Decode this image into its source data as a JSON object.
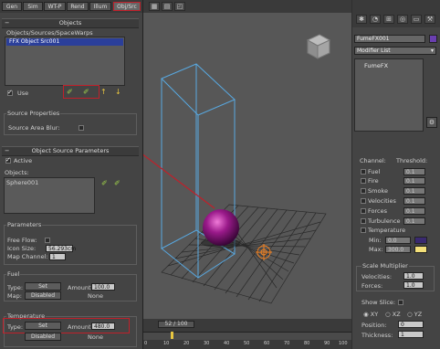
{
  "left_tabs": [
    "Gen",
    "Sim",
    "WT-P",
    "Rend",
    "Illum",
    "Obj/Src"
  ],
  "objects_rollout": {
    "title": "Objects",
    "list_header": "Objects/Sources/SpaceWarps",
    "items": [
      "FFX Object Src001"
    ],
    "use_label": "Use"
  },
  "source_properties": {
    "group_label": "Source Properties",
    "area_blur_label": "Source Area Blur:"
  },
  "object_source_parameters": {
    "title": "Object Source Parameters",
    "active_label": "Active",
    "objects_label": "Objects:",
    "objects_list": [
      "Sphere001"
    ]
  },
  "parameters": {
    "group_label": "Parameters",
    "free_flow_label": "Free Flow:",
    "icon_size_label": "Icon Size:",
    "icon_size_value": "56.293cm",
    "map_channel_label": "Map Channel:",
    "map_channel_value": "1"
  },
  "fuel": {
    "group_label": "Fuel",
    "type_label": "Type:",
    "type_value": "Set",
    "amount_label": "Amount:",
    "amount_value": "100.0",
    "map_label": "Map:",
    "map_value": "Disabled",
    "none_label": "None"
  },
  "temperature": {
    "group_label": "Temperature",
    "type_label": "Type:",
    "type_value": "Set",
    "amount_label": "Amount:",
    "amount_value": "480.0",
    "map_value": "Disabled",
    "none_label": "None"
  },
  "timeline": {
    "frame_label": "52 / 100",
    "ticks": [
      "0",
      "10",
      "20",
      "30",
      "40",
      "50",
      "60",
      "70",
      "80",
      "90",
      "100"
    ]
  },
  "right_panel": {
    "object_name": "FumeFX001",
    "modifier_list_label": "Modifier List",
    "stack_item": "FumeFX",
    "channel_label": "Channel:",
    "threshold_label": "Threshold:",
    "channels": [
      {
        "name": "Fuel",
        "value": "0.1"
      },
      {
        "name": "Fire",
        "value": "0.1"
      },
      {
        "name": "Smoke",
        "value": "0.1"
      },
      {
        "name": "Velocities",
        "value": "0.1"
      },
      {
        "name": "Forces",
        "value": "0.1"
      },
      {
        "name": "Turbulence",
        "value": "0.1"
      },
      {
        "name": "Temperature",
        "value": ""
      }
    ],
    "min_label": "Min:",
    "min_value": "0.0",
    "max_label": "Max:",
    "max_value": "300.0",
    "scale_multiplier_label": "Scale Multiplier",
    "velocities_label": "Velocities:",
    "velocities_value": "1.0",
    "forces_label": "Forces:",
    "forces_value": "1.0",
    "show_slice_label": "Show Slice:",
    "axis_xy": "XY",
    "axis_xz": "XZ",
    "axis_yz": "YZ",
    "position_label": "Position:",
    "position_value": "0",
    "thickness_label": "Thickness:",
    "thickness_value": "1",
    "colors": {
      "obj_swatch": "#6a3fb0",
      "min_swatch": "#3a2a70",
      "max_swatch": "#f4e07a"
    }
  },
  "colors": {
    "highlight_red": "#c0202a",
    "sphere": "#9a1a8a",
    "bbox": "#58a8e0"
  }
}
